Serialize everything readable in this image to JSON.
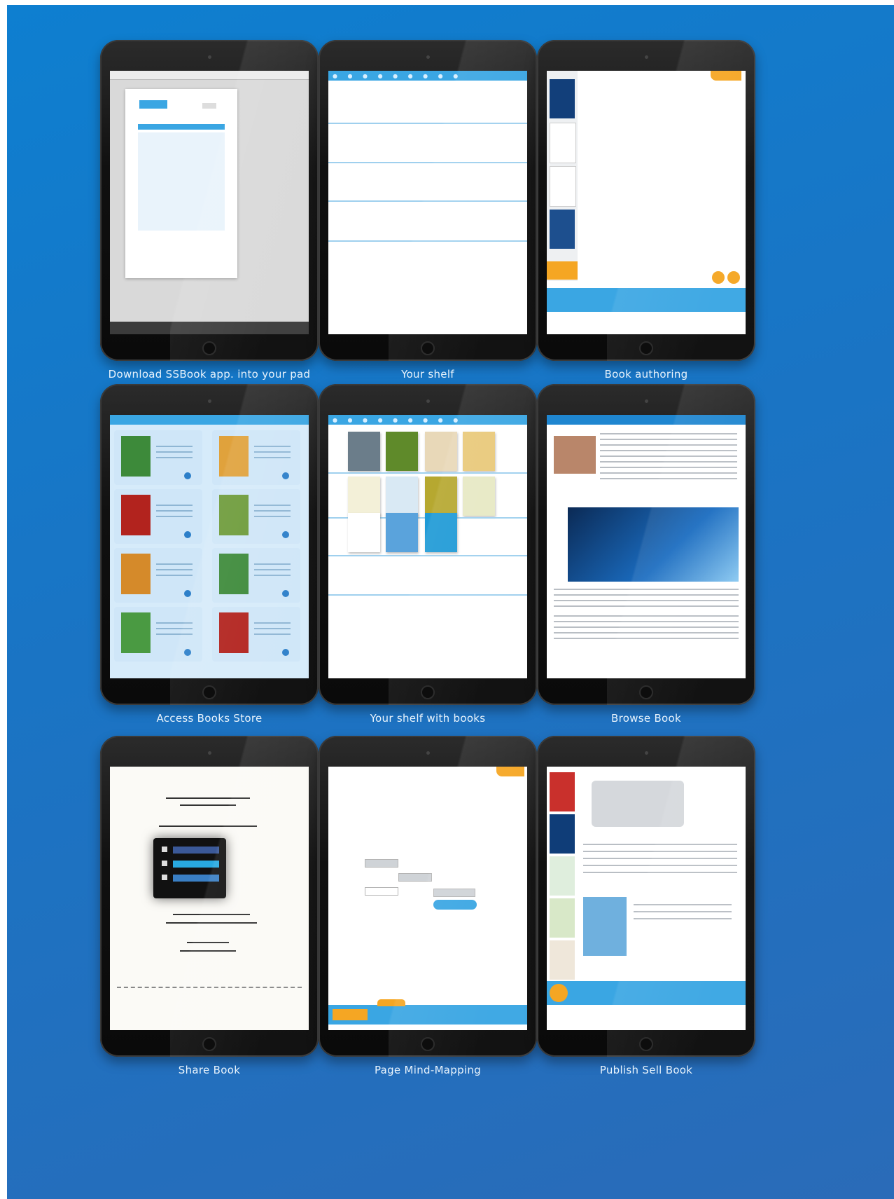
{
  "tiles": [
    {
      "caption": "Download SSBook app. into your pad"
    },
    {
      "caption": "Your shelf"
    },
    {
      "caption": "Book authoring"
    },
    {
      "caption": "Access Books Store"
    },
    {
      "caption": "Your shelf with books"
    },
    {
      "caption": "Browse Book"
    },
    {
      "caption": "Share Book"
    },
    {
      "caption": "Page Mind-Mapping"
    },
    {
      "caption": "Publish Sell Book"
    }
  ],
  "colors": {
    "background": "#1a74c4",
    "accent_blue": "#3aa6e3",
    "accent_orange": "#f5a623",
    "device": "#111111"
  },
  "icons": [
    "apple-icon",
    "camera-icon",
    "microphone-icon",
    "pen-icon",
    "plus-icon",
    "share-icon"
  ]
}
